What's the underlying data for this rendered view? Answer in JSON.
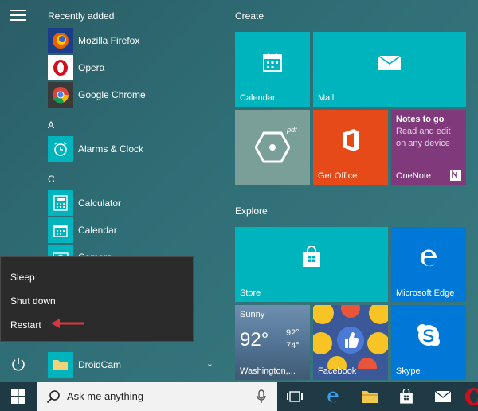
{
  "applist": {
    "recently_added": "Recently added",
    "apps_recent": [
      {
        "label": "Mozilla Firefox",
        "icon": "firefox-icon"
      },
      {
        "label": "Opera",
        "icon": "opera-icon"
      },
      {
        "label": "Google Chrome",
        "icon": "chrome-icon"
      }
    ],
    "letter_a": "A",
    "apps_a": [
      {
        "label": "Alarms & Clock",
        "icon": "alarm-clock-icon"
      }
    ],
    "letter_c": "C",
    "apps_c": [
      {
        "label": "Calculator",
        "icon": "calculator-icon"
      },
      {
        "label": "Calendar",
        "icon": "calendar-icon"
      },
      {
        "label": "Camera",
        "icon": "camera-icon"
      }
    ],
    "droidcam": {
      "label": "DroidCam",
      "icon": "folder-icon",
      "chevron": "⌄"
    }
  },
  "power_menu": {
    "sleep": "Sleep",
    "shutdown": "Shut down",
    "restart": "Restart"
  },
  "tiles": {
    "create_label": "Create",
    "explore_label": "Explore",
    "calendar": "Calendar",
    "mail": "Mail",
    "pdf": {
      "label": "pdf",
      "icon": "hexagon-icon"
    },
    "get_office": "Get Office",
    "onenote": {
      "label": "OneNote",
      "heading": "Notes to go",
      "body": "Read and edit on any device"
    },
    "store": "Store",
    "edge": "Microsoft Edge",
    "weather": {
      "condition": "Sunny",
      "temp": "92°",
      "high": "92°",
      "low": "74°",
      "location": "Washington,..."
    },
    "facebook": "Facebook",
    "skype": "Skype"
  },
  "taskbar": {
    "search_placeholder": "Ask me anything"
  },
  "colors": {
    "tile_teal": "#00b4be",
    "tile_blue": "#0078d7",
    "tile_orange": "#e64a19",
    "tile_purple": "#80397b",
    "annotation_red": "#d9363e"
  }
}
